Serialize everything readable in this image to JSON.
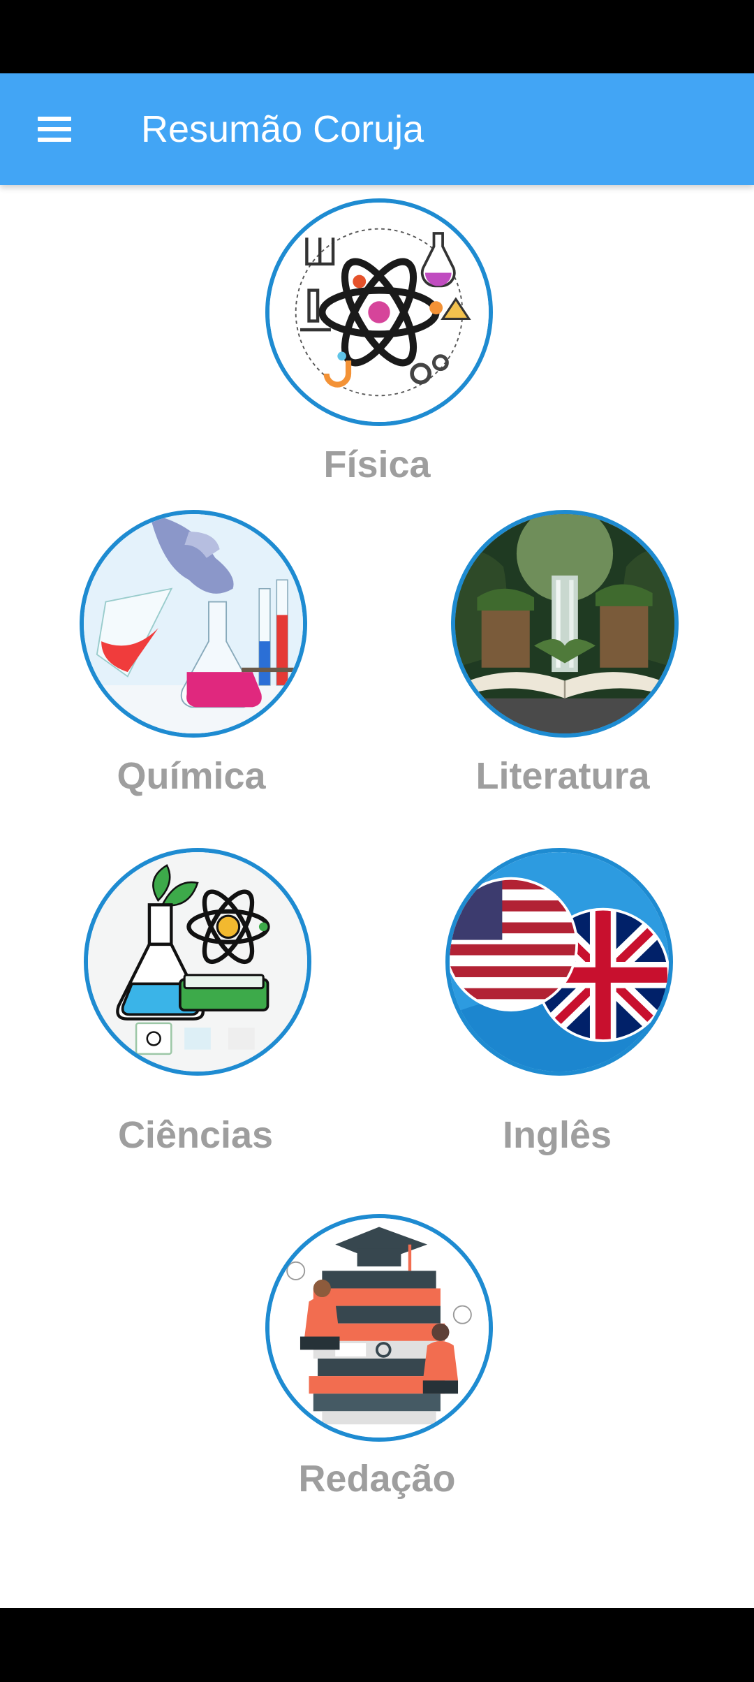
{
  "app_bar": {
    "title": "Resumão Coruja",
    "menu_icon": "hamburger-menu-icon"
  },
  "colors": {
    "app_bar": "#42A5F5",
    "ring": "#1E8BD1",
    "label": "#9E9E9E"
  },
  "subjects": [
    {
      "label": "Física",
      "icon": "atom-science-icon"
    },
    {
      "label": "Química",
      "icon": "chemistry-flasks-image"
    },
    {
      "label": "Literatura",
      "icon": "open-book-waterfall-image"
    },
    {
      "label": "Ciências",
      "icon": "science-lab-icon"
    },
    {
      "label": "Inglês",
      "icon": "usa-uk-flags-icon"
    },
    {
      "label": "Redação",
      "icon": "books-graduation-icon"
    }
  ]
}
